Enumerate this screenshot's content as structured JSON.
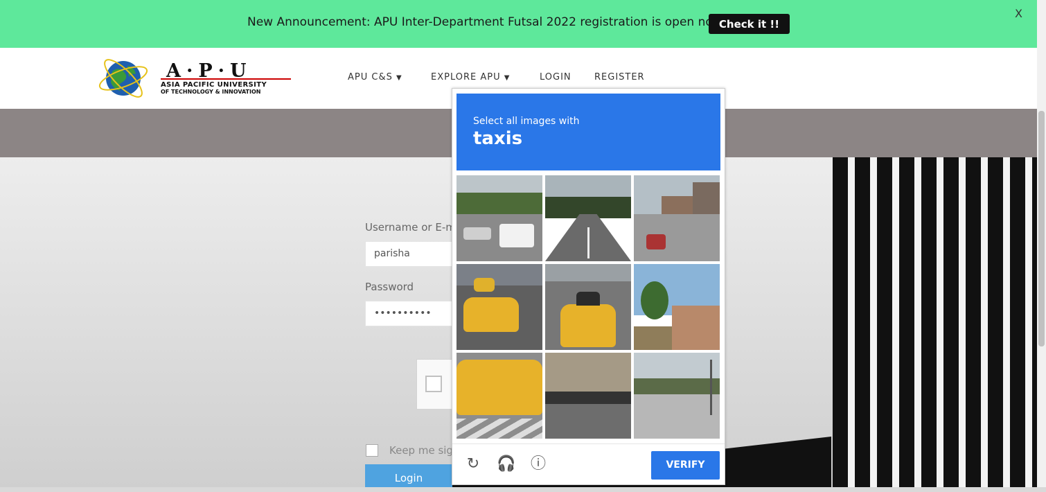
{
  "banner": {
    "text": "New Announcement: APU Inter-Department Futsal 2022 registration is open now!!",
    "button": "Check it !!",
    "close": "X"
  },
  "logo": {
    "main": "A·P·U",
    "sub1": "ASIA PACIFIC UNIVERSITY",
    "sub2": "OF TECHNOLOGY & INNOVATION"
  },
  "nav": {
    "items": [
      "APU C&S",
      "EXPLORE APU",
      "LOGIN",
      "REGISTER"
    ]
  },
  "form": {
    "username_label": "Username or E-m",
    "username_value": "parisha",
    "password_label": "Password",
    "password_value": "••••••••••",
    "keep_label": "Keep me sig",
    "login_button": "Login"
  },
  "captcha": {
    "instruction": "Select all images with",
    "object": "taxis",
    "verify_button": "VERIFY",
    "footer_icons": [
      "reload-icon",
      "headphones-icon",
      "info-icon"
    ]
  }
}
